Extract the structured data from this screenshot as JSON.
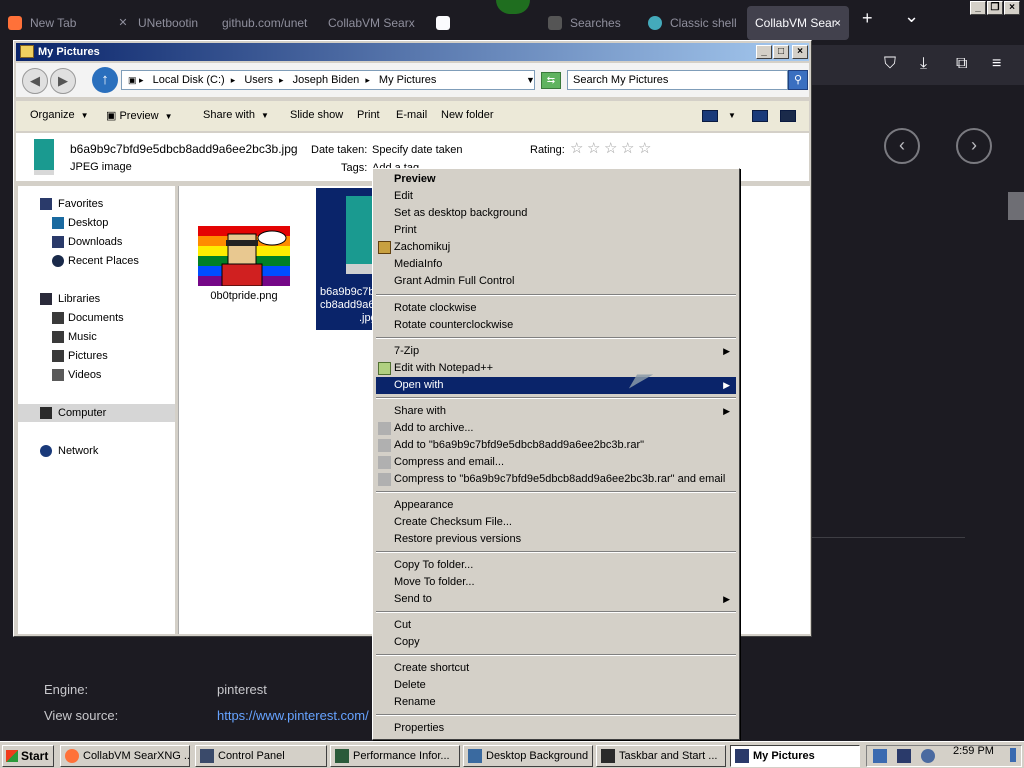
{
  "browser": {
    "tabs": [
      {
        "label": "New Tab"
      },
      {
        "label": "UNetbootin"
      },
      {
        "label": "github.com/unet"
      },
      {
        "label": "CollabVM Searx"
      },
      {
        "label": ""
      },
      {
        "label": "Searches"
      },
      {
        "label": "Classic shell"
      },
      {
        "label": "CollabVM Sear"
      }
    ],
    "new_tab": "+",
    "tab_list": "⌄",
    "nav_icons": [
      "pocket-icon",
      "download-icon",
      "extensions-icon",
      "menu-icon"
    ]
  },
  "page": {
    "prev_glyph": "‹",
    "next_glyph": "›",
    "engine_label": "Engine:",
    "engine_value": "pinterest",
    "source_label": "View source:",
    "source_value": "https://www.pinterest.com/"
  },
  "explorer": {
    "title": "My Pictures",
    "title_buttons": {
      "min": "_",
      "max": "□",
      "close": "×"
    },
    "address": {
      "crumbs": [
        "Local Disk (C:)",
        "Users",
        "Joseph Biden",
        "My Pictures"
      ]
    },
    "search_placeholder": "Search My Pictures",
    "toolbar": {
      "organize": "Organize",
      "preview": "Preview",
      "share_with": "Share with",
      "slide_show": "Slide show",
      "print": "Print",
      "email": "E-mail",
      "new_folder": "New folder"
    },
    "details": {
      "filename": "b6a9b9c7bfd9e5dbcb8add9a6ee2bc3b.jpg",
      "filetype": "JPEG image",
      "date_label": "Date taken:",
      "date_value": "Specify date taken",
      "tags_label": "Tags:",
      "tags_value": "Add a tag",
      "rating_label": "Rating:",
      "stars": [
        "☆",
        "☆",
        "☆",
        "☆",
        "☆"
      ]
    },
    "sidebar": {
      "favorites": "Favorites",
      "desktop": "Desktop",
      "downloads": "Downloads",
      "recent": "Recent Places",
      "libraries": "Libraries",
      "documents": "Documents",
      "music": "Music",
      "pictures": "Pictures",
      "videos": "Videos",
      "computer": "Computer",
      "network": "Network"
    },
    "files": [
      {
        "name": "0b0tpride.png"
      },
      {
        "name_line1": "b6a9b9c7b",
        "name_line2": "cb8add9a6",
        "name_line3": ".jpg"
      }
    ]
  },
  "context_menu": {
    "preview": "Preview",
    "edit": "Edit",
    "desktop_bg": "Set as desktop background",
    "print": "Print",
    "zachomikuj": "Zachomikuj",
    "mediainfo": "MediaInfo",
    "grant": "Grant Admin Full Control",
    "rot_cw": "Rotate clockwise",
    "rot_ccw": "Rotate counterclockwise",
    "zip": "7-Zip",
    "notepad": "Edit with Notepad++",
    "open_with": "Open with",
    "share_with": "Share with",
    "add_archive": "Add to archive...",
    "add_rar": "Add to \"b6a9b9c7bfd9e5dbcb8add9a6ee2bc3b.rar\"",
    "compress_email": "Compress and email...",
    "compress_rar_email": "Compress to \"b6a9b9c7bfd9e5dbcb8add9a6ee2bc3b.rar\" and email",
    "appearance": "Appearance",
    "checksum": "Create Checksum File...",
    "restore": "Restore previous versions",
    "copy_to": "Copy To folder...",
    "move_to": "Move To folder...",
    "send_to": "Send to",
    "cut": "Cut",
    "copy": "Copy",
    "shortcut": "Create shortcut",
    "delete": "Delete",
    "rename": "Rename",
    "properties": "Properties",
    "submenu_arrow": "▶"
  },
  "taskbar": {
    "start": "Start",
    "tasks": [
      {
        "label": "CollabVM SearXNG ..."
      },
      {
        "label": "Control Panel"
      },
      {
        "label": "Performance Infor..."
      },
      {
        "label": "Desktop Background"
      },
      {
        "label": "Taskbar and Start ..."
      },
      {
        "label": "My Pictures"
      }
    ],
    "clock": "2:59 PM"
  },
  "colors": {
    "titlebar_start": "#0a246a",
    "titlebar_end": "#a6caf0",
    "menu_highlight": "#0a246a",
    "firefox_bg": "#1c1b22",
    "link": "#66a3ff"
  }
}
